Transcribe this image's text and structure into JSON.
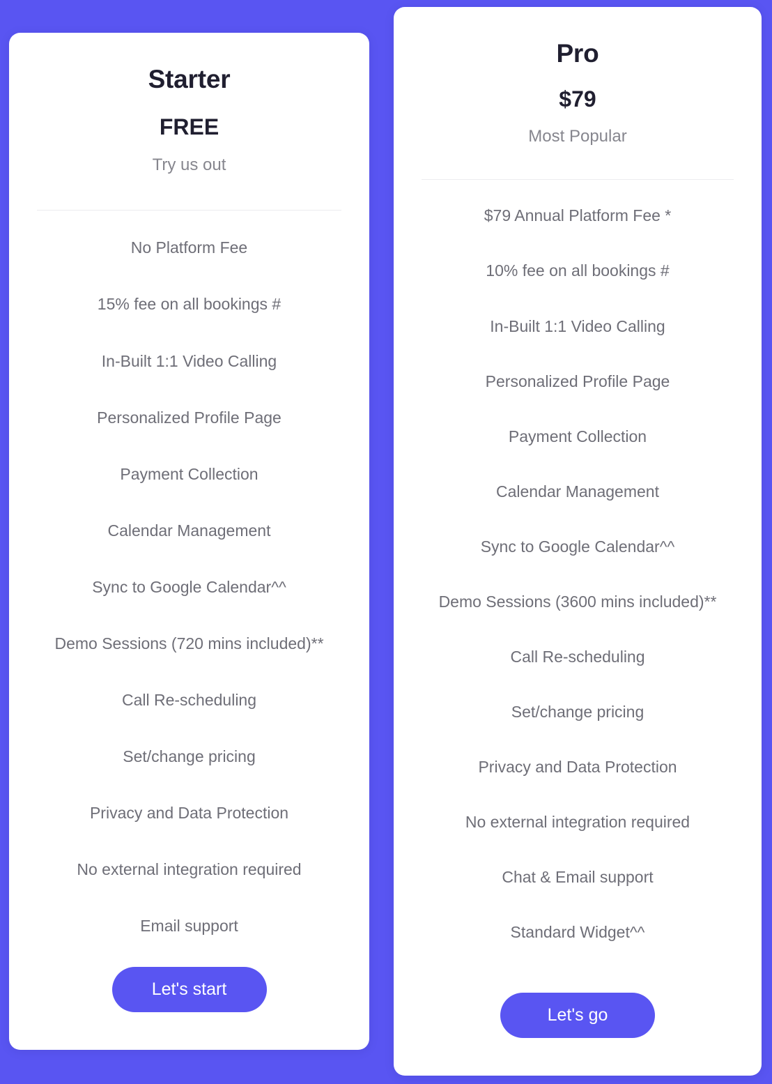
{
  "theme": {
    "background_color": "#5955f2",
    "card_background": "#ffffff",
    "accent_color": "#5955f2",
    "heading_color": "#201f30",
    "feature_text_color": "#6e6e77",
    "tagline_color": "#86868e",
    "divider_color": "#ececef"
  },
  "plans": [
    {
      "id": "starter",
      "name": "Starter",
      "price": "FREE",
      "tagline": "Try us out",
      "features": [
        "No Platform Fee",
        "15% fee on all bookings #",
        "In-Built 1:1 Video Calling",
        "Personalized Profile Page",
        "Payment Collection",
        "Calendar Management",
        "Sync to Google Calendar^^",
        "Demo Sessions (720 mins included)**",
        "Call Re-scheduling",
        "Set/change pricing",
        "Privacy and Data Protection",
        "No external integration required",
        "Email support"
      ],
      "cta_label": "Let's start"
    },
    {
      "id": "pro",
      "name": "Pro",
      "price": "$79",
      "tagline": "Most Popular",
      "features": [
        "$79 Annual Platform Fee *",
        "10% fee on all bookings #",
        "In-Built 1:1 Video Calling",
        "Personalized Profile Page",
        "Payment Collection",
        "Calendar Management",
        "Sync to Google Calendar^^",
        "Demo Sessions (3600 mins included)**",
        "Call Re-scheduling",
        "Set/change pricing",
        "Privacy and Data Protection",
        "No external integration required",
        "Chat & Email support",
        "Standard Widget^^"
      ],
      "cta_label": "Let's go"
    }
  ]
}
